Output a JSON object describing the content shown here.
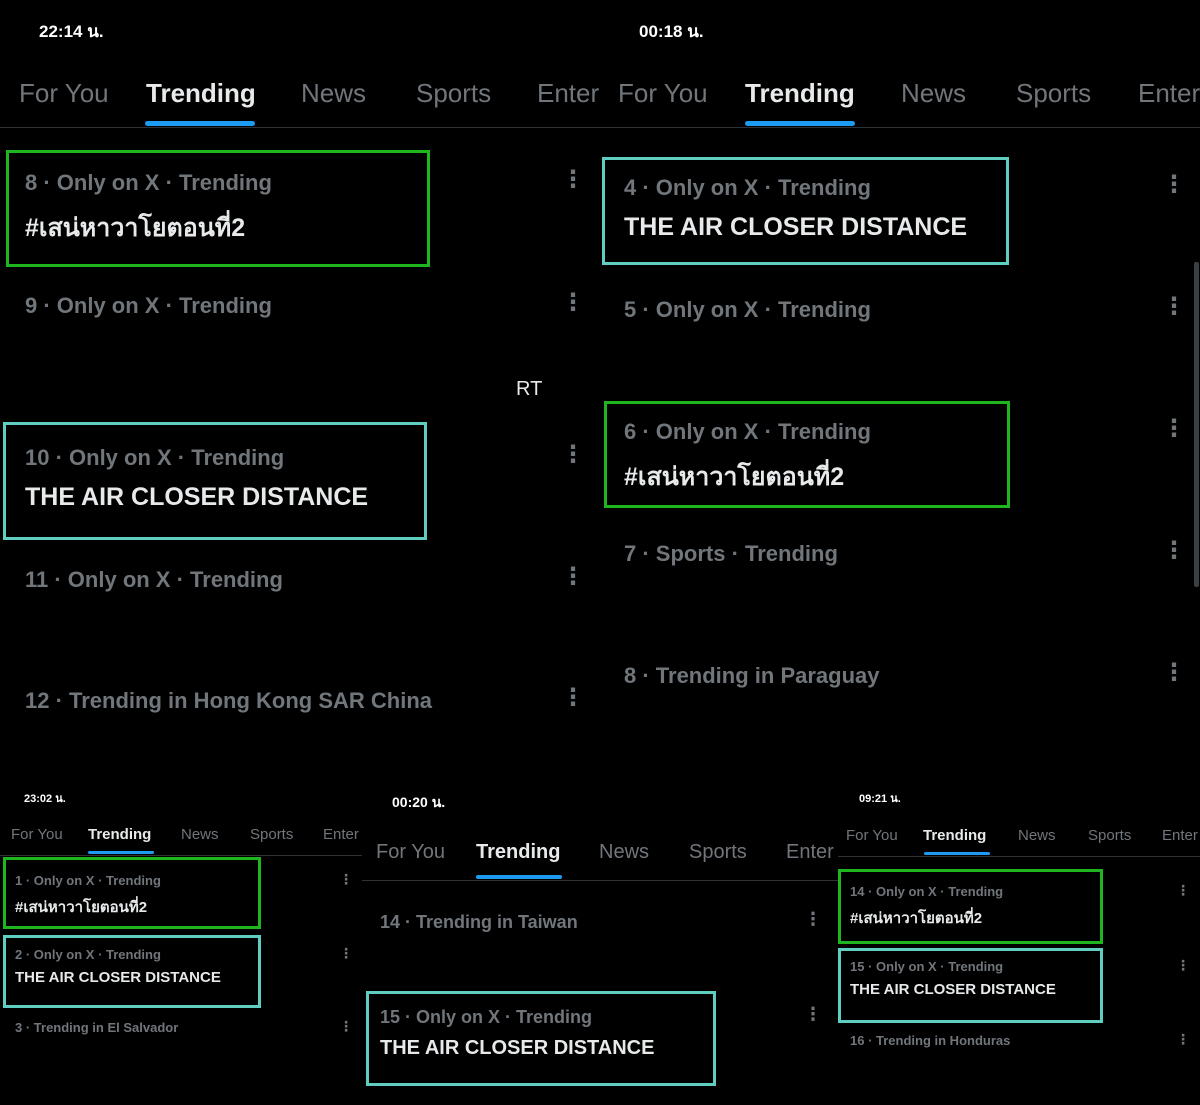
{
  "tabs": [
    "For You",
    "Trending",
    "News",
    "Sports",
    "Enter"
  ],
  "more_glyph": "⋮",
  "colors": {
    "green_box": "#1fb51f",
    "teal_box": "#5fcdbf",
    "accent": "#1d9bf0"
  },
  "p1": {
    "time": "22:14 น.",
    "stray_text": "RT",
    "rows": [
      {
        "meta": "8 · Only on X · Trending",
        "topic": "#เสน่หาวาโยตอนที่2"
      },
      {
        "meta": "9 · Only on X · Trending"
      },
      {
        "meta": "10 · Only on X · Trending",
        "topic": "THE AIR CLOSER DISTANCE"
      },
      {
        "meta": "11 · Only on X · Trending"
      },
      {
        "meta": "12 · Trending in Hong Kong SAR China"
      }
    ]
  },
  "p2": {
    "time": "00:18 น.",
    "rows": [
      {
        "meta": "4 · Only on X · Trending",
        "topic": "THE AIR CLOSER DISTANCE"
      },
      {
        "meta": "5 · Only on X · Trending"
      },
      {
        "meta": "6 · Only on X · Trending",
        "topic": "#เสน่หาวาโยตอนที่2"
      },
      {
        "meta": "7 · Sports · Trending"
      },
      {
        "meta": "8 · Trending in Paraguay"
      }
    ]
  },
  "p3": {
    "time": "23:02 น.",
    "rows": [
      {
        "meta": "1 · Only on X · Trending",
        "topic": "#เสน่หาวาโยตอนที่2"
      },
      {
        "meta": "2 · Only on X · Trending",
        "topic": "THE AIR CLOSER DISTANCE"
      },
      {
        "meta": "3 · Trending in El Salvador"
      }
    ]
  },
  "p4": {
    "time": "00:20 น.",
    "rows": [
      {
        "meta": "14 · Trending in Taiwan"
      },
      {
        "meta": "15 · Only on X · Trending",
        "topic": "THE AIR CLOSER DISTANCE"
      }
    ]
  },
  "p5": {
    "time": "09:21 น.",
    "rows": [
      {
        "meta": "14 · Only on X · Trending",
        "topic": "#เสน่หาวาโยตอนที่2"
      },
      {
        "meta": "15 · Only on X · Trending",
        "topic": "THE AIR CLOSER DISTANCE"
      },
      {
        "meta": "16 · Trending in Honduras"
      }
    ]
  }
}
